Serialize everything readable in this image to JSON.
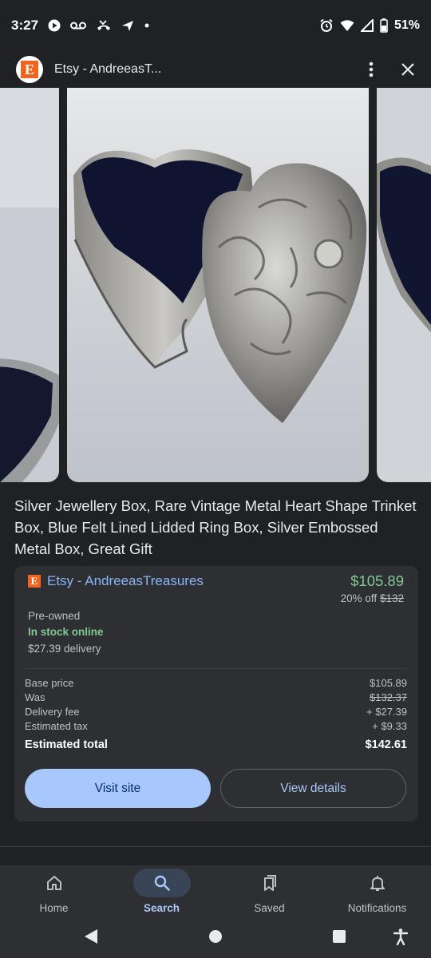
{
  "status_bar": {
    "time": "3:27",
    "battery": "51%"
  },
  "header": {
    "site_title": "Etsy - AndreeasT..."
  },
  "product": {
    "title": "Silver Jewellery Box, Rare Vintage Metal Heart Shape Trinket Box, Blue Felt Lined Lidded Ring Box, Silver Embossed Metal Box, Great Gift"
  },
  "offer": {
    "seller": "Etsy - AndreeasTreasures",
    "price": "$105.89",
    "discount_label": "20% off",
    "original_price": "$132",
    "condition": "Pre-owned",
    "stock": "In stock online",
    "delivery": "$27.39 delivery",
    "breakdown": [
      {
        "label": "Base price",
        "value": "$105.89"
      },
      {
        "label": "Was",
        "value": "$132.37"
      },
      {
        "label": "Delivery fee",
        "value": "+ $27.39"
      },
      {
        "label": "Estimated tax",
        "value": "+ $9.33"
      }
    ],
    "total_label": "Estimated total",
    "total_value": "$142.61",
    "visit_button": "Visit site",
    "details_button": "View details"
  },
  "bottom_nav": {
    "items": [
      {
        "label": "Home",
        "icon": "home-icon"
      },
      {
        "label": "Search",
        "icon": "search-icon",
        "active": true
      },
      {
        "label": "Saved",
        "icon": "bookmarks-icon"
      },
      {
        "label": "Notifications",
        "icon": "bell-icon"
      }
    ]
  },
  "colors": {
    "background": "#202124",
    "card": "#2d2f32",
    "link": "#8ab4f8",
    "price_green": "#81c995",
    "primary_button": "#a8c7fa",
    "etsy_orange": "#f1641e"
  }
}
